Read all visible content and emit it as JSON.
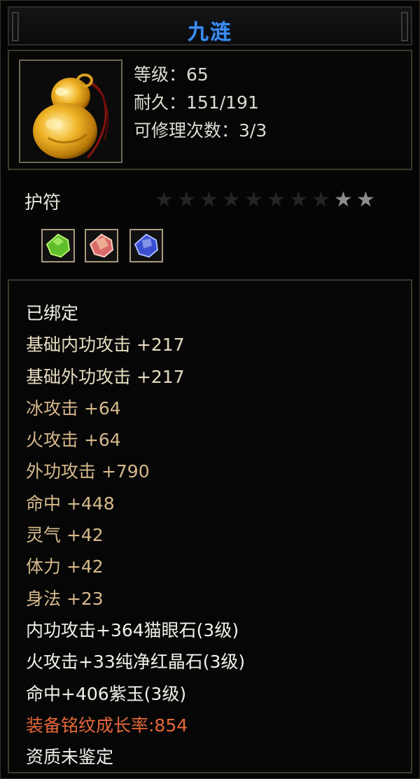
{
  "title": "九涟",
  "item": {
    "icon": "jade-gourd-amulet-icon",
    "stats": [
      "等级：65",
      "耐久：151/191",
      "可修理次数：3/3"
    ]
  },
  "type_label": "护符",
  "stars": {
    "total": 10,
    "filled": 2
  },
  "gems": [
    {
      "icon": "green-gem-icon",
      "color": "#5fbf2a"
    },
    {
      "icon": "red-gem-icon",
      "color": "#d86a6a"
    },
    {
      "icon": "blue-gem-icon",
      "color": "#3a4fd0"
    }
  ],
  "attributes": [
    {
      "text": "已绑定",
      "color": "#f2f0e8"
    },
    {
      "text": "基础内功攻击  +217",
      "color": "#e6dcc0"
    },
    {
      "text": "基础外功攻击  +217",
      "color": "#e6dcc0"
    },
    {
      "text": "冰攻击  +64",
      "color": "#d6b98c"
    },
    {
      "text": "火攻击  +64",
      "color": "#d6b98c"
    },
    {
      "text": "外功攻击  +790",
      "color": "#d6b98c"
    },
    {
      "text": "命中  +448",
      "color": "#d6b98c"
    },
    {
      "text": "灵气  +42",
      "color": "#d6b98c"
    },
    {
      "text": "体力  +42",
      "color": "#d6b98c"
    },
    {
      "text": "身法  +23",
      "color": "#d6b98c"
    },
    {
      "text": "内功攻击+364猫眼石(3级)",
      "color": "#f2f0e8"
    },
    {
      "text": "火攻击+33纯净红晶石(3级)",
      "color": "#f2f0e8"
    },
    {
      "text": "命中+406紫玉(3级)",
      "color": "#f2f0e8"
    },
    {
      "text": "装备铭纹成长率:854",
      "color": "#e5683a"
    },
    {
      "text": "资质未鉴定",
      "color": "#f2f0e8"
    }
  ]
}
